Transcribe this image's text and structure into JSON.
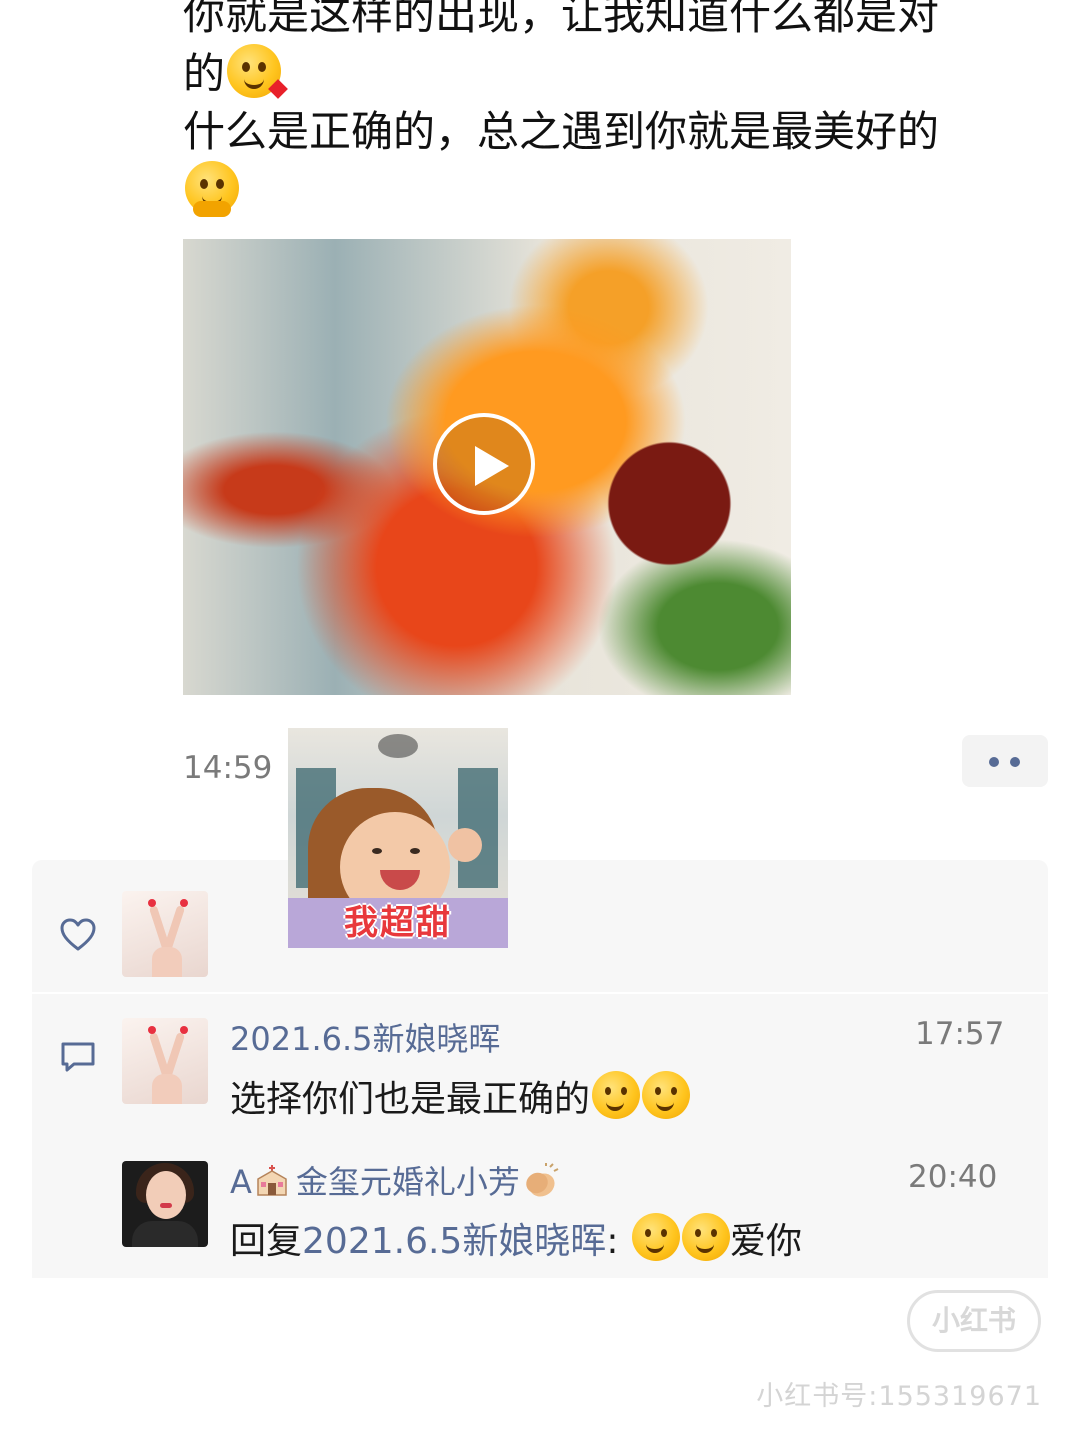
{
  "post": {
    "line1": "你就是这样的出现，让我知道什么都是对",
    "line2": "的",
    "line3": "什么是正确的，总之遇到你就是最美好的"
  },
  "icons": {
    "post_emoji_1": "kissing-face-emoji",
    "post_emoji_2": "hugging-face-emoji",
    "play": "play-icon",
    "more": "more-dots-icon",
    "like": "heart-icon",
    "comment": "comment-icon",
    "chapel": "wedding-chapel-emoji",
    "clap": "clapping-hands-emoji"
  },
  "meta": {
    "timestamp": "14:59"
  },
  "sticker": {
    "caption": "我超甜"
  },
  "comments": [
    {
      "author": "2021.6.5新娘晓晖",
      "time": "17:57",
      "text": "选择你们也是最正确的"
    },
    {
      "author_prefix": "A",
      "author": "金玺元婚礼小芳",
      "time": "20:40",
      "reply_prefix": "回复",
      "reply_to": "2021.6.5新娘晓晖",
      "reply_colon": ":",
      "text": "爱你"
    }
  ],
  "watermark": {
    "logo": "小红书",
    "id": "小红书号:155319671"
  },
  "colors": {
    "link": "#576b95",
    "panel_bg": "#f7f7f7",
    "timestamp": "#7a7a7a"
  }
}
